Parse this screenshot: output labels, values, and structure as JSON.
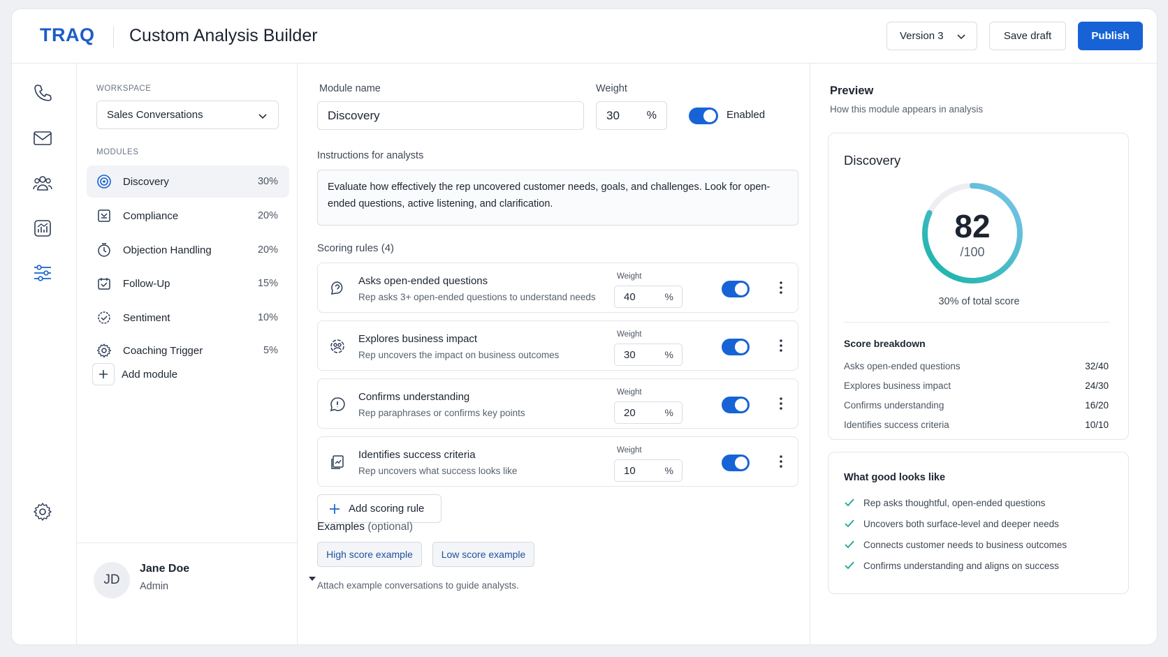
{
  "header": {
    "logo": "TRAQ",
    "title": "Custom Analysis Builder",
    "version_label": "Version 3",
    "save_label": "Save draft",
    "publish_label": "Publish"
  },
  "rail": {
    "icons": [
      "phone-icon",
      "mail-icon",
      "users-icon",
      "analytics-icon",
      "sliders-icon",
      "settings-icon"
    ],
    "active": "sliders-icon"
  },
  "sidebar": {
    "workspace_label": "WORKSPACE",
    "workspace_value": "Sales Conversations",
    "modules_label": "MODULES",
    "modules": [
      {
        "label": "Discovery",
        "pct": "30%",
        "icon": "target-icon",
        "active": true
      },
      {
        "label": "Compliance",
        "pct": "20%",
        "icon": "shield-check-icon",
        "active": false
      },
      {
        "label": "Objection Handling",
        "pct": "20%",
        "icon": "clock-icon",
        "active": false
      },
      {
        "label": "Follow-Up",
        "pct": "15%",
        "icon": "calendar-check-icon",
        "active": false
      },
      {
        "label": "Sentiment",
        "pct": "10%",
        "icon": "sentiment-icon",
        "active": false
      },
      {
        "label": "Coaching Trigger",
        "pct": "5%",
        "icon": "gear-icon",
        "active": false
      }
    ],
    "add_module_label": "Add module",
    "user": {
      "initials": "JD",
      "name": "Jane Doe",
      "role": "Admin"
    }
  },
  "editor": {
    "module_name_label": "Module name",
    "module_name_value": "Discovery",
    "weight_label": "Weight",
    "weight_value": "30",
    "weight_unit": "%",
    "enabled_label": "Enabled",
    "enabled": true,
    "instructions_label": "Instructions for analysts",
    "instructions_value": "Evaluate how effectively the rep uncovered customer needs, goals, and challenges. Look for open-ended questions, active listening, and clarification.",
    "scoring_rules_label": "Scoring rules (4)",
    "rule_weight_label": "Weight",
    "rules": [
      {
        "title": "Asks open-ended questions",
        "desc": "Rep asks 3+ open-ended questions to understand needs",
        "weight": "40",
        "enabled": true,
        "icon": "question-chat-icon"
      },
      {
        "title": "Explores business impact",
        "desc": "Rep uncovers the impact on business outcomes",
        "weight": "30",
        "enabled": true,
        "icon": "impact-icon"
      },
      {
        "title": "Confirms understanding",
        "desc": "Rep paraphrases or confirms key points",
        "weight": "20",
        "enabled": true,
        "icon": "alert-bubble-icon"
      },
      {
        "title": "Identifies success criteria",
        "desc": "Rep uncovers what success looks like",
        "weight": "10",
        "enabled": true,
        "icon": "document-chart-icon"
      }
    ],
    "add_rule_label": "Add scoring rule",
    "examples_label": "Examples",
    "examples_optional": "(optional)",
    "high_example_label": "High score example",
    "low_example_label": "Low score example",
    "examples_help": "Attach example conversations to guide analysts."
  },
  "preview": {
    "title": "Preview",
    "subtitle": "How this module appears in analysis",
    "module_name": "Discovery",
    "score": "82",
    "score_max": "/100",
    "score_fraction": 0.82,
    "share_label": "30% of total score",
    "breakdown_title": "Score breakdown",
    "breakdown": [
      {
        "label": "Asks open-ended questions",
        "value": "32/40"
      },
      {
        "label": "Explores business impact",
        "value": "24/30"
      },
      {
        "label": "Confirms understanding",
        "value": "16/20"
      },
      {
        "label": "Identifies success criteria",
        "value": "10/10"
      }
    ],
    "good_title": "What good looks like",
    "good_items": [
      "Rep asks thoughtful, open-ended questions",
      "Uncovers both surface-level and deeper needs",
      "Connects customer needs to business outcomes",
      "Confirms understanding and aligns on success"
    ]
  },
  "colors": {
    "accent": "#1763d6",
    "logo": "#1d5cc7",
    "gauge_start": "#14b3a6",
    "gauge_end": "#7cc4ea",
    "check": "#1aa497"
  }
}
